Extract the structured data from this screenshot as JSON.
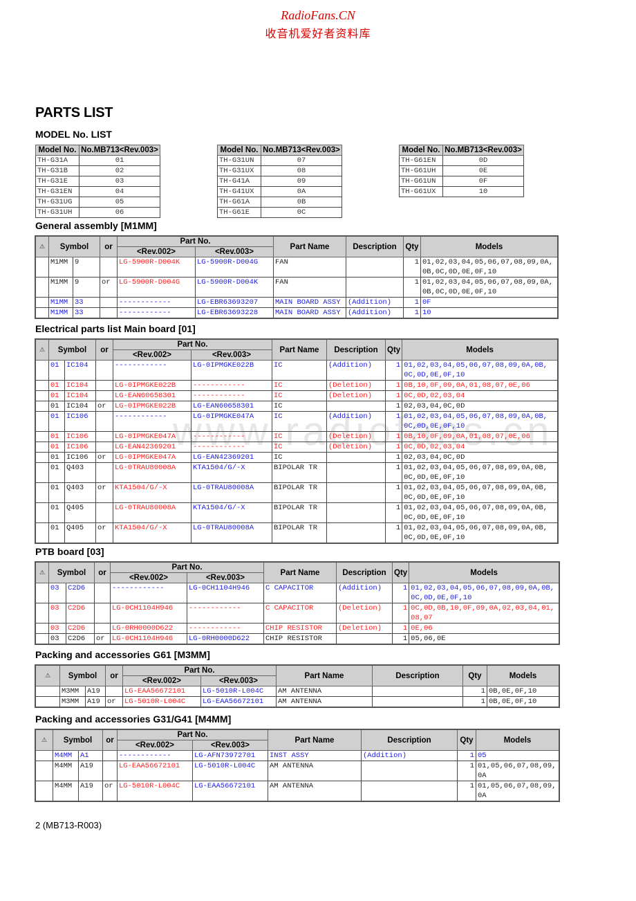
{
  "watermark": {
    "line1": "RadioFans.CN",
    "line2": "收音机爱好者资料库",
    "center": "www.radiofans.cn"
  },
  "title": "PARTS LIST",
  "model_list": {
    "heading": "MODEL No. LIST",
    "col_model": "Model No.",
    "col_no": "No.MB713<Rev.003>",
    "tables": [
      [
        [
          "TH-G31A",
          "01"
        ],
        [
          "TH-G31B",
          "02"
        ],
        [
          "TH-G31E",
          "03"
        ],
        [
          "TH-G31EN",
          "04"
        ],
        [
          "TH-G31UG",
          "05"
        ],
        [
          "TH-G31UH",
          "06"
        ]
      ],
      [
        [
          "TH-G31UN",
          "07"
        ],
        [
          "TH-G31UX",
          "08"
        ],
        [
          "TH-G41A",
          "09"
        ],
        [
          "TH-G41UX",
          "0A"
        ],
        [
          "TH-G61A",
          "0B"
        ],
        [
          "TH-G61E",
          "0C"
        ]
      ],
      [
        [
          "TH-G61EN",
          "0D"
        ],
        [
          "TH-G61UH",
          "0E"
        ],
        [
          "TH-G61UN",
          "0F"
        ],
        [
          "TH-G61UX",
          "10"
        ]
      ]
    ]
  },
  "headers": {
    "warn": "⚠",
    "symbol": "Symbol",
    "or": "or",
    "part_no": "Part No.",
    "rev002": "<Rev.002>",
    "rev003": "<Rev.003>",
    "part_name": "Part Name",
    "description": "Description",
    "qty": "Qty",
    "models": "Models"
  },
  "sections": [
    {
      "heading": "General assembly [M1MM]",
      "rows": [
        {
          "s1": "M1MM",
          "s2": "9",
          "or": "",
          "r2": "LG-5900R-D004K",
          "r3": "LG-5900R-D004G",
          "name": "FAN",
          "desc": "",
          "qty": "1",
          "models": "01,02,03,04,05,06,07,08,09,0A, 0B,0C,0D,0E,0F,10",
          "c": {
            "sym": "blk",
            "r2": "red",
            "r3": "blue",
            "name": "blk",
            "desc": "blk",
            "models": "blk"
          }
        },
        {
          "s1": "M1MM",
          "s2": "9",
          "or": "or",
          "r2": "LG-5900R-D004G",
          "r3": "LG-5900R-D004K",
          "name": "FAN",
          "desc": "",
          "qty": "1",
          "models": "01,02,03,04,05,06,07,08,09,0A, 0B,0C,0D,0E,0F,10",
          "c": {
            "sym": "blk",
            "r2": "red",
            "r3": "blue",
            "name": "blk",
            "desc": "blk",
            "models": "blk"
          }
        },
        {
          "s1": "M1MM",
          "s2": "33",
          "or": "",
          "r2": "------------",
          "r3": "LG-EBR63693207",
          "name": "MAIN BOARD ASSY",
          "desc": "(Addition)",
          "qty": "1",
          "models": "0F",
          "c": {
            "sym": "blue",
            "r2": "blue",
            "r3": "blue",
            "name": "blue",
            "desc": "blue",
            "models": "blue"
          }
        },
        {
          "s1": "M1MM",
          "s2": "33",
          "or": "",
          "r2": "------------",
          "r3": "LG-EBR63693228",
          "name": "MAIN BOARD ASSY",
          "desc": "(Addition)",
          "qty": "1",
          "models": "10",
          "c": {
            "sym": "blue",
            "r2": "blue",
            "r3": "blue",
            "name": "blue",
            "desc": "blue",
            "models": "blue"
          }
        }
      ]
    },
    {
      "heading": "Electrical parts list Main board [01]",
      "rows": [
        {
          "s1": "01",
          "s2": "IC104",
          "or": "",
          "r2": "------------",
          "r3": "LG-0IPMGKE022B",
          "name": "IC",
          "desc": "(Addition)",
          "qty": "1",
          "models": "01,02,03,04,05,06,07,08,09,0A,0B, 0C,0D,0E,0F,10",
          "c": {
            "sym": "blue",
            "r2": "blue",
            "r3": "blue",
            "name": "blue",
            "desc": "blue",
            "models": "blue"
          }
        },
        {
          "s1": "01",
          "s2": "IC104",
          "or": "",
          "r2": "LG-0IPMGKE022B",
          "r3": "------------",
          "name": "IC",
          "desc": "(Deletion)",
          "qty": "1",
          "models": "0B,10,0F,09,0A,01,08,07,0E,06",
          "c": {
            "sym": "red",
            "r2": "red",
            "r3": "red",
            "name": "red",
            "desc": "red",
            "models": "red"
          }
        },
        {
          "s1": "01",
          "s2": "IC104",
          "or": "",
          "r2": "LG-EAN60658301",
          "r3": "------------",
          "name": "IC",
          "desc": "(Deletion)",
          "qty": "1",
          "models": "0C,0D,02,03,04",
          "c": {
            "sym": "red",
            "r2": "red",
            "r3": "red",
            "name": "red",
            "desc": "red",
            "models": "red"
          }
        },
        {
          "s1": "01",
          "s2": "IC104",
          "or": "or",
          "r2": "LG-0IPMGKE022B",
          "r3": "LG-EAN60658301",
          "name": "IC",
          "desc": "",
          "qty": "1",
          "models": "02,03,04,0C,0D",
          "c": {
            "sym": "blk",
            "r2": "red",
            "r3": "blue",
            "name": "blk",
            "desc": "blk",
            "models": "blk"
          }
        },
        {
          "s1": "01",
          "s2": "IC106",
          "or": "",
          "r2": "------------",
          "r3": "LG-0IPMGKE047A",
          "name": "IC",
          "desc": "(Addition)",
          "qty": "1",
          "models": "01,02,03,04,05,06,07,08,09,0A,0B, 0C,0D,0E,0F,10",
          "c": {
            "sym": "blue",
            "r2": "blue",
            "r3": "blue",
            "name": "blue",
            "desc": "blue",
            "models": "blue"
          }
        },
        {
          "s1": "01",
          "s2": "IC106",
          "or": "",
          "r2": "LG-0IPMGKE047A",
          "r3": "------------",
          "name": "IC",
          "desc": "(Deletion)",
          "qty": "1",
          "models": "0B,10,0F,09,0A,01,08,07,0E,06",
          "c": {
            "sym": "red",
            "r2": "red",
            "r3": "red",
            "name": "red",
            "desc": "red",
            "models": "red"
          }
        },
        {
          "s1": "01",
          "s2": "IC106",
          "or": "",
          "r2": "LG-EAN42369201",
          "r3": "------------",
          "name": "IC",
          "desc": "(Deletion)",
          "qty": "1",
          "models": "0C,0D,02,03,04",
          "c": {
            "sym": "red",
            "r2": "red",
            "r3": "red",
            "name": "red",
            "desc": "red",
            "models": "red"
          }
        },
        {
          "s1": "01",
          "s2": "IC106",
          "or": "or",
          "r2": "LG-0IPMGKE047A",
          "r3": "LG-EAN42369201",
          "name": "IC",
          "desc": "",
          "qty": "1",
          "models": "02,03,04,0C,0D",
          "c": {
            "sym": "blk",
            "r2": "red",
            "r3": "blue",
            "name": "blk",
            "desc": "blk",
            "models": "blk"
          }
        },
        {
          "s1": "01",
          "s2": "Q403",
          "or": "",
          "r2": "LG-0TRAU80008A",
          "r3": "KTA1504/G/-X",
          "name": "BIPOLAR TR",
          "desc": "",
          "qty": "1",
          "models": "01,02,03,04,05,06,07,08,09,0A,0B, 0C,0D,0E,0F,10",
          "c": {
            "sym": "blk",
            "r2": "red",
            "r3": "blue",
            "name": "blk",
            "desc": "blk",
            "models": "blk"
          }
        },
        {
          "s1": "01",
          "s2": "Q403",
          "or": "or",
          "r2": "KTA1504/G/-X",
          "r3": "LG-0TRAU80008A",
          "name": "BIPOLAR TR",
          "desc": "",
          "qty": "1",
          "models": "01,02,03,04,05,06,07,08,09,0A,0B, 0C,0D,0E,0F,10",
          "c": {
            "sym": "blk",
            "r2": "red",
            "r3": "blue",
            "name": "blk",
            "desc": "blk",
            "models": "blk"
          }
        },
        {
          "s1": "01",
          "s2": "Q405",
          "or": "",
          "r2": "LG-0TRAU80008A",
          "r3": "KTA1504/G/-X",
          "name": "BIPOLAR TR",
          "desc": "",
          "qty": "1",
          "models": "01,02,03,04,05,06,07,08,09,0A,0B, 0C,0D,0E,0F,10",
          "c": {
            "sym": "blk",
            "r2": "red",
            "r3": "blue",
            "name": "blk",
            "desc": "blk",
            "models": "blk"
          }
        },
        {
          "s1": "01",
          "s2": "Q405",
          "or": "or",
          "r2": "KTA1504/G/-X",
          "r3": "LG-0TRAU80008A",
          "name": "BIPOLAR TR",
          "desc": "",
          "qty": "1",
          "models": "01,02,03,04,05,06,07,08,09,0A,0B, 0C,0D,0E,0F,10",
          "c": {
            "sym": "blk",
            "r2": "red",
            "r3": "blue",
            "name": "blk",
            "desc": "blk",
            "models": "blk"
          }
        }
      ]
    },
    {
      "heading": "PTB board [03]",
      "rows": [
        {
          "s1": "03",
          "s2": "C2D6",
          "or": "",
          "r2": "------------",
          "r3": "LG-0CH1104H946",
          "name": "C CAPACITOR",
          "desc": "(Addition)",
          "qty": "1",
          "models": "01,02,03,04,05,06,07,08,09,0A,0B, 0C,0D,0E,0F,10",
          "c": {
            "sym": "blue",
            "r2": "blue",
            "r3": "blue",
            "name": "blue",
            "desc": "blue",
            "models": "blue"
          }
        },
        {
          "s1": "03",
          "s2": "C2D6",
          "or": "",
          "r2": "LG-0CH1104H946",
          "r3": "------------",
          "name": "C CAPACITOR",
          "desc": "(Deletion)",
          "qty": "1",
          "models": "0C,0D,0B,10,0F,09,0A,02,03,04,01, 08,07",
          "c": {
            "sym": "red",
            "r2": "red",
            "r3": "red",
            "name": "red",
            "desc": "red",
            "models": "red"
          }
        },
        {
          "s1": "03",
          "s2": "C2D6",
          "or": "",
          "r2": "LG-0RH0000D622",
          "r3": "------------",
          "name": "CHIP RESISTOR",
          "desc": "(Deletion)",
          "qty": "1",
          "models": "0E,06",
          "c": {
            "sym": "red",
            "r2": "red",
            "r3": "red",
            "name": "red",
            "desc": "red",
            "models": "red"
          }
        },
        {
          "s1": "03",
          "s2": "C2D6",
          "or": "or",
          "r2": "LG-0CH1104H946",
          "r3": "LG-0RH0000D622",
          "name": "CHIP RESISTOR",
          "desc": "",
          "qty": "1",
          "models": "05,06,0E",
          "c": {
            "sym": "blk",
            "r2": "red",
            "r3": "blue",
            "name": "blk",
            "desc": "blk",
            "models": "blk"
          }
        }
      ]
    },
    {
      "heading": "Packing and accessories G61 [M3MM]",
      "rows": [
        {
          "s1": "M3MM",
          "s2": "A19",
          "or": "",
          "r2": "LG-EAA56672101",
          "r3": "LG-5010R-L004C",
          "name": "AM ANTENNA",
          "desc": "",
          "qty": "1",
          "models": "0B,0E,0F,10",
          "c": {
            "sym": "blk",
            "r2": "red",
            "r3": "blue",
            "name": "blk",
            "desc": "blk",
            "models": "blk"
          }
        },
        {
          "s1": "M3MM",
          "s2": "A19",
          "or": "or",
          "r2": "LG-5010R-L004C",
          "r3": "LG-EAA56672101",
          "name": "AM ANTENNA",
          "desc": "",
          "qty": "1",
          "models": "0B,0E,0F,10",
          "c": {
            "sym": "blk",
            "r2": "red",
            "r3": "blue",
            "name": "blk",
            "desc": "blk",
            "models": "blk"
          }
        }
      ]
    },
    {
      "heading": "Packing and accessories G31/G41 [M4MM]",
      "rows": [
        {
          "s1": "M4MM",
          "s2": "A1",
          "or": "",
          "r2": "------------",
          "r3": "LG-AFN73972701",
          "name": "INST ASSY",
          "desc": "(Addition)",
          "qty": "1",
          "models": "05",
          "c": {
            "sym": "blue",
            "r2": "blue",
            "r3": "blue",
            "name": "blue",
            "desc": "blue",
            "models": "blue"
          }
        },
        {
          "s1": "M4MM",
          "s2": "A19",
          "or": "",
          "r2": "LG-EAA56672101",
          "r3": "LG-5010R-L004C",
          "name": "AM ANTENNA",
          "desc": "",
          "qty": "1",
          "models": "01,05,06,07,08,09,0A",
          "c": {
            "sym": "blk",
            "r2": "red",
            "r3": "blue",
            "name": "blk",
            "desc": "blk",
            "models": "blk"
          }
        },
        {
          "s1": "M4MM",
          "s2": "A19",
          "or": "or",
          "r2": "LG-5010R-L004C",
          "r3": "LG-EAA56672101",
          "name": "AM ANTENNA",
          "desc": "",
          "qty": "1",
          "models": "01,05,06,07,08,09,0A",
          "c": {
            "sym": "blk",
            "r2": "red",
            "r3": "blue",
            "name": "blk",
            "desc": "blk",
            "models": "blk"
          }
        }
      ]
    }
  ],
  "footer": "2 (MB713-R003)"
}
